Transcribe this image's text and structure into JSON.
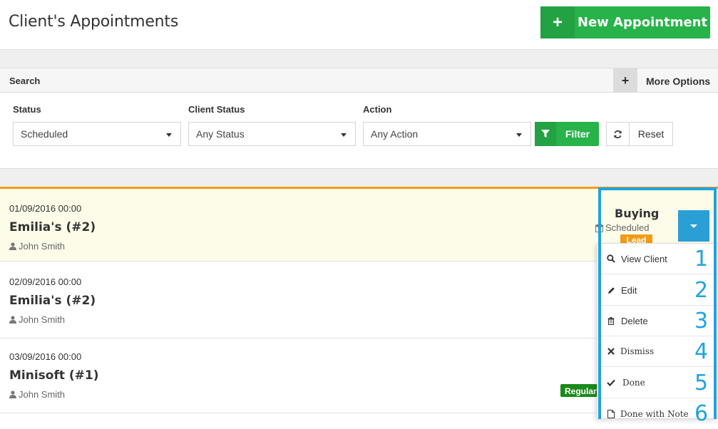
{
  "header": {
    "title": "Client's Appointments",
    "new_button_label": "New Appointment"
  },
  "search": {
    "title": "Search",
    "more_options": "More Options",
    "status_label": "Status",
    "status_value": "Scheduled",
    "client_status_label": "Client Status",
    "client_status_value": "Any Status",
    "action_label": "Action",
    "action_value": "Any Action",
    "filter_label": "Filter",
    "reset_label": "Reset"
  },
  "appointments": [
    {
      "date": "01/09/2016 00:00",
      "name": "Emilia's (#2)",
      "user": "John Smith"
    },
    {
      "date": "02/09/2016 00:00",
      "name": "Emilia's (#2)",
      "user": "John Smith"
    },
    {
      "date": "03/09/2016 00:00",
      "name": "Minisoft (#1)",
      "user": "John Smith"
    }
  ],
  "selected": {
    "title": "Buying",
    "status": "Scheduled",
    "badge": "Lead"
  },
  "regular_badge": "Regular",
  "menu": [
    {
      "label": "View Client",
      "icon": "search-icon",
      "num": "1"
    },
    {
      "label": "Edit",
      "icon": "pencil-icon",
      "num": "2"
    },
    {
      "label": "Delete",
      "icon": "trash-icon",
      "num": "3"
    },
    {
      "label": "Dismiss",
      "icon": "x-icon",
      "num": "4"
    },
    {
      "label": "Done",
      "icon": "check-icon",
      "num": "5"
    },
    {
      "label": "Done with Note",
      "icon": "file-icon",
      "num": "6"
    }
  ],
  "colors": {
    "green": "#27b24a",
    "blue": "#2a9fd6",
    "annotation_blue": "#1fa3e0",
    "orange": "#f39c12",
    "highlight_bg": "#fdfce9"
  }
}
